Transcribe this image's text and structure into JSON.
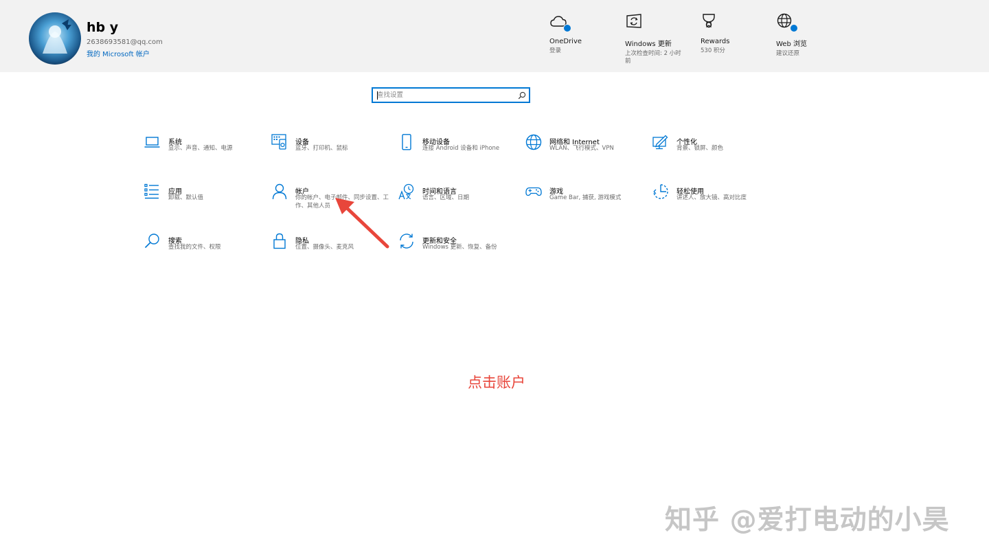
{
  "colors": {
    "accent": "#0078d4",
    "link": "#0067c0",
    "header_bg": "#f2f2f2",
    "annotation": "#e8463b"
  },
  "user": {
    "name": "hb y",
    "email": "2638693581@qq.com",
    "account_link": "我的 Microsoft 帐户"
  },
  "status_items": [
    {
      "title": "OneDrive",
      "sub": "登录",
      "icon": "cloud-icon"
    },
    {
      "title": "Windows 更新",
      "sub": "上次检查时间: 2 小时前",
      "icon": "windows-update-icon"
    },
    {
      "title": "Rewards",
      "sub": "530 积分",
      "icon": "trophy-icon"
    },
    {
      "title": "Web 浏览",
      "sub": "建议还原",
      "icon": "globe-icon"
    }
  ],
  "search": {
    "placeholder": "查找设置"
  },
  "tiles": [
    {
      "title": "系统",
      "desc": "显示、声音、通知、电源",
      "icon": "laptop-icon"
    },
    {
      "title": "设备",
      "desc": "蓝牙、打印机、鼠标",
      "icon": "devices-icon"
    },
    {
      "title": "移动设备",
      "desc": "连接 Android 设备和 iPhone",
      "icon": "phone-icon"
    },
    {
      "title": "网络和 Internet",
      "desc": "WLAN、飞行模式、VPN",
      "icon": "globe-icon"
    },
    {
      "title": "个性化",
      "desc": "背景、锁屏、颜色",
      "icon": "personalization-icon"
    },
    {
      "title": "应用",
      "desc": "卸载、默认值",
      "icon": "apps-list-icon"
    },
    {
      "title": "帐户",
      "desc": "你的帐户、电子邮件、同步设置、工作、其他人员",
      "icon": "person-icon"
    },
    {
      "title": "时间和语言",
      "desc": "语言、区域、日期",
      "icon": "time-language-icon"
    },
    {
      "title": "游戏",
      "desc": "Game Bar, 捕获, 游戏模式",
      "icon": "gamepad-icon"
    },
    {
      "title": "轻松使用",
      "desc": "讲述人、放大镜、高对比度",
      "icon": "ease-of-access-icon"
    },
    {
      "title": "搜索",
      "desc": "查找我的文件、权限",
      "icon": "search-icon"
    },
    {
      "title": "隐私",
      "desc": "位置、摄像头、麦克风",
      "icon": "lock-icon"
    },
    {
      "title": "更新和安全",
      "desc": "Windows 更新、恢复、备份",
      "icon": "refresh-icon"
    }
  ],
  "annotation": {
    "text": "点击账户"
  },
  "watermark": {
    "text": "知乎 @爱打电动的小昊"
  }
}
